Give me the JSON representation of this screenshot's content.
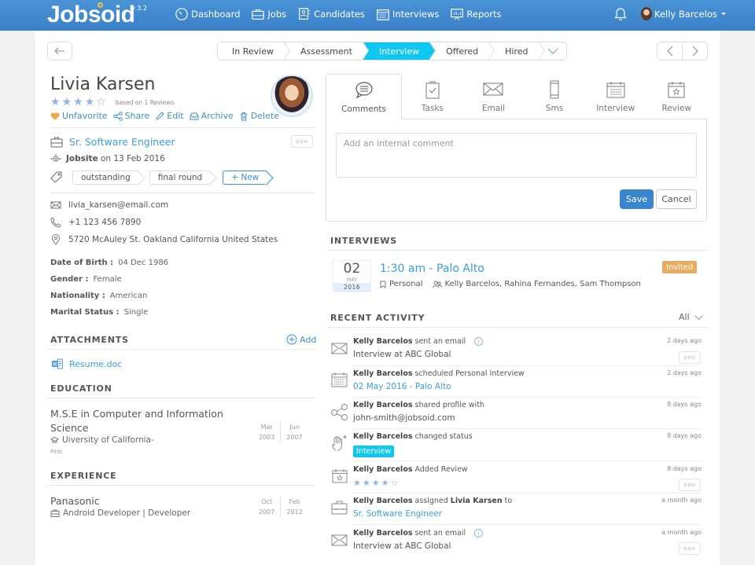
{
  "app": {
    "logo": "Jobsoid",
    "version": "v 3.2",
    "nav": [
      {
        "label": "Dashboard",
        "icon": "dashboard-icon"
      },
      {
        "label": "Jobs",
        "icon": "briefcase-icon"
      },
      {
        "label": "Candidates",
        "icon": "candidates-icon"
      },
      {
        "label": "Interviews",
        "icon": "calendar-icon"
      },
      {
        "label": "Reports",
        "icon": "reports-icon"
      }
    ],
    "user": "Kelly Barcelos"
  },
  "pipeline": {
    "stages": [
      "In Review",
      "Assessment",
      "Interview",
      "Offered",
      "Hired"
    ],
    "active": "Interview"
  },
  "candidate": {
    "name": "Livia Karsen",
    "rating": 4,
    "rating_max": 5,
    "rating_note": "based on 1 Reviews",
    "actions": [
      "Unfavorite",
      "Share",
      "Edit",
      "Archive",
      "Delete"
    ],
    "job_title": "Sr. Software Engineer",
    "source": "Jobsite",
    "source_date": "on 13 Feb 2016",
    "tags": [
      "outstanding",
      "final round"
    ],
    "new_tag_label": "+ New",
    "email": "livia_karsen@email.com",
    "phone": "+1 123 456 7890",
    "address": "5720 McAuley St. Oakland California United States",
    "details": [
      {
        "label": "Date of Birth :",
        "value": "04 Dec 1986"
      },
      {
        "label": "Gender :",
        "value": "Female"
      },
      {
        "label": "Nationality :",
        "value": "American"
      },
      {
        "label": "Marital Status :",
        "value": "Single"
      }
    ]
  },
  "attachments": {
    "title": "ATTACHMENTS",
    "add_label": "Add",
    "files": [
      "Resume.doc"
    ]
  },
  "education": {
    "title": "EDUCATION",
    "items": [
      {
        "degree_line1": "M.S.E in Computer and Information",
        "degree_line2": "Science",
        "school": "Uiversity of California-",
        "note": "First",
        "start_month": "Mar",
        "start_year": "2003",
        "end_month": "Jun",
        "end_year": "2007"
      }
    ]
  },
  "experience": {
    "title": "EXPERIENCE",
    "items": [
      {
        "company": "Panasonic",
        "role": "Android Developer | Developer",
        "start_month": "Oct",
        "start_year": "2007",
        "end_month": "Feb",
        "end_year": "2012"
      }
    ]
  },
  "tabs": [
    {
      "label": "Comments",
      "icon": "comment-icon",
      "active": true
    },
    {
      "label": "Tasks",
      "icon": "clipboard-icon"
    },
    {
      "label": "Email",
      "icon": "envelope-icon"
    },
    {
      "label": "Sms",
      "icon": "phone-icon"
    },
    {
      "label": "Interview",
      "icon": "calendar-icon"
    },
    {
      "label": "Review",
      "icon": "review-icon"
    }
  ],
  "comment": {
    "placeholder": "Add an internal comment",
    "value": "",
    "save_label": "Save",
    "cancel_label": "Cancel"
  },
  "interviews": {
    "title": "INTERVIEWS",
    "items": [
      {
        "day": "02",
        "month": "MAY",
        "year": "2016",
        "title": "1:30 am - Palo Alto",
        "type": "Personal",
        "participants": "Kelly Barcelos, Rahina Fernandes, Sam Thompson",
        "status": "Invited"
      }
    ]
  },
  "activity": {
    "title": "RECENT ACTIVITY",
    "filter": "All",
    "items": [
      {
        "icon": "envelope-icon",
        "actor": "Kelly Barcelos",
        "text": "sent an email",
        "detail": "Interview at ABC Global",
        "time": "2 days ago"
      },
      {
        "icon": "calendar-icon",
        "actor": "Kelly Barcelos",
        "text": "scheduled Personal Interview",
        "detail": "02 May 2016 - Palo Alto",
        "time": "2 days ago"
      },
      {
        "icon": "share-icon",
        "actor": "Kelly Barcelos",
        "text": "shared profile with",
        "detail": "john-smith@jobsoid.com",
        "time": "8 days ago"
      },
      {
        "icon": "hand-icon",
        "actor": "Kelly Barcelos",
        "text": "changed status",
        "detail": "Interview",
        "time": "8 days ago"
      },
      {
        "icon": "review-icon",
        "actor": "Kelly Barcelos",
        "text": "Added Review",
        "rating": 4,
        "time": "8 days ago"
      },
      {
        "icon": "briefcase-icon",
        "actor": "Kelly Barcelos",
        "text": "assigned",
        "target": "Livia Karsen",
        "text2": "to",
        "detail": "Sr. Software Engineer",
        "time": "a month ago"
      },
      {
        "icon": "envelope-icon",
        "actor": "Kelly Barcelos",
        "text": "sent an email",
        "detail": "Interview at ABC Global",
        "time": "a month ago"
      }
    ]
  },
  "colors": {
    "brand": "#3a86cc",
    "link": "#3a9ee0",
    "active_stage": "#0fc8f1",
    "invited": "#e6ac5f",
    "favorite": "#f0a94a"
  }
}
